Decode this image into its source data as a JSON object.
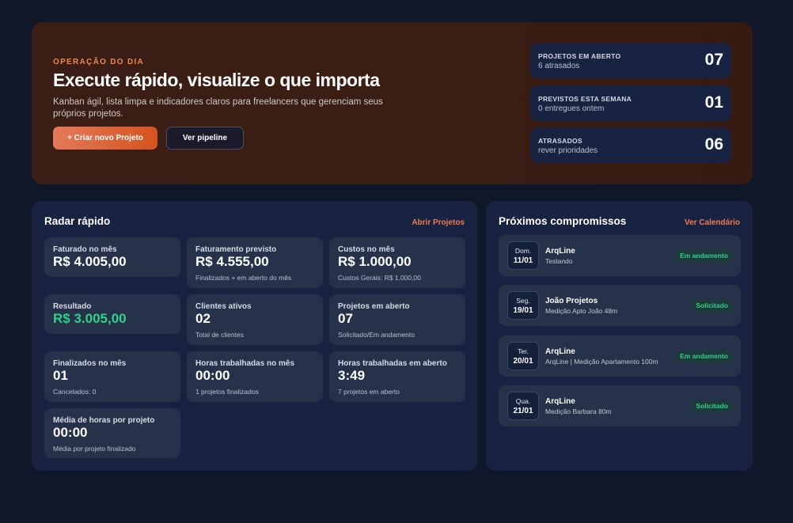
{
  "hero": {
    "eyebrow": "OPERAÇÃO DO DIA",
    "title": "Execute rápido, visualize o que importa",
    "subtitle": "Kanban ágil, lista limpa e indicadores claros para freelancers que gerenciam seus próprios projetos.",
    "primary_button": "+ Criar novo Projeto",
    "secondary_button": "Ver pipeline",
    "stats": [
      {
        "label": "PROJETOS EM ABERTO",
        "sub": "6 atrasados",
        "value": "07"
      },
      {
        "label": "PREVISTOS ESTA SEMANA",
        "sub": "0 entregues ontem",
        "value": "01"
      },
      {
        "label": "ATRASADOS",
        "sub": "rever prioridades",
        "value": "06"
      }
    ]
  },
  "radar": {
    "title": "Radar rápido",
    "link": "Abrir Projetos",
    "metrics": [
      {
        "label": "Faturado no mês",
        "value": "R$ 4.005,00",
        "sub": ""
      },
      {
        "label": "Faturamento previsto",
        "value": "R$ 4.555,00",
        "sub": "Finalizados + em aberto do mês"
      },
      {
        "label": "Custos no mês",
        "value": "R$ 1.000,00",
        "sub": "Custos Gerais: R$ 1.000,00"
      },
      {
        "label": "Resultado",
        "value": "R$ 3.005,00",
        "sub": ""
      },
      {
        "label": "Clientes ativos",
        "value": "02",
        "sub": "Total de clientes"
      },
      {
        "label": "Projetos em aberto",
        "value": "07",
        "sub": "Solicitado/Em andamento"
      },
      {
        "label": "Finalizados no mês",
        "value": "01",
        "sub": "Cancelados: 0"
      },
      {
        "label": "Horas trabalhadas no mês",
        "value": "00:00",
        "sub": "1 projetos finalizados"
      },
      {
        "label": "Horas trabalhadas em aberto",
        "value": "3:49",
        "sub": "7 projetos em aberto"
      },
      {
        "label": "Média de horas por projeto",
        "value": "00:00",
        "sub": "Média por projeto finalizado"
      }
    ]
  },
  "agenda": {
    "title": "Próximos compromissos",
    "link": "Ver Calendário",
    "items": [
      {
        "dow": "Dom.",
        "day": "11/01",
        "title": "ArqLine",
        "sub": "Testando",
        "status": "Em andamento"
      },
      {
        "dow": "Seg.",
        "day": "19/01",
        "title": "João Projetos",
        "sub": "Medição Apto João 48m",
        "status": "Solicitado"
      },
      {
        "dow": "Ter.",
        "day": "20/01",
        "title": "ArqLine",
        "sub": "ArqLine | Medição Apartamento 100m",
        "status": "Em andamento"
      },
      {
        "dow": "Qua.",
        "day": "21/01",
        "title": "ArqLine",
        "sub": "Medição Barbara 80m",
        "status": "Solicitado"
      }
    ]
  },
  "colors": {
    "accent": "#e0602f",
    "positive": "#2ed18a",
    "background": "#0f1729",
    "card": "#172341"
  }
}
